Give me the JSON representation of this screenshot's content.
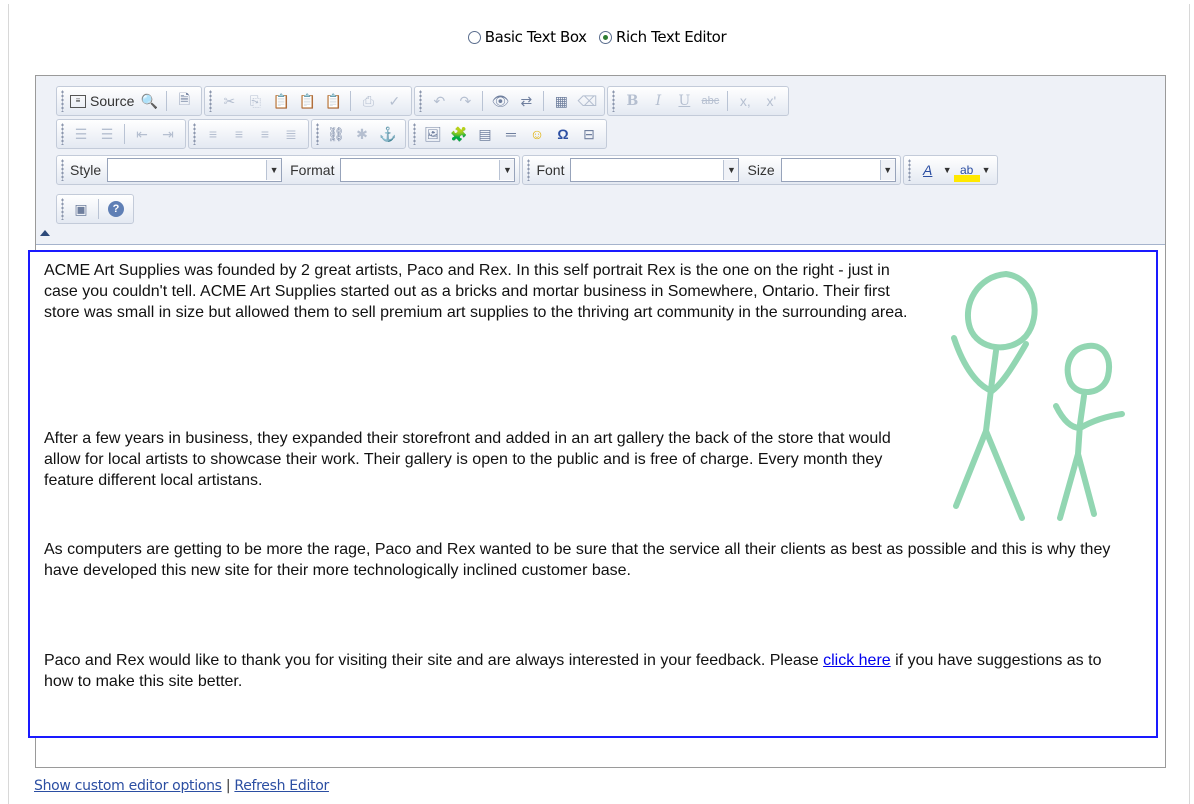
{
  "mode_selector": {
    "basic_label": "Basic Text Box",
    "rich_label": "Rich Text Editor",
    "selected": "Rich Text Editor"
  },
  "toolbar": {
    "source_label": "Source",
    "style_label": "Style",
    "style_value": "",
    "format_label": "Format",
    "format_value": "",
    "font_label": "Font",
    "font_value": "",
    "size_label": "Size",
    "size_value": "",
    "bold_glyph": "B",
    "italic_glyph": "I",
    "underline_glyph": "U",
    "strike_glyph": "abc",
    "subscript_glyph": "x,",
    "superscript_glyph": "x'",
    "omega_glyph": "Ω",
    "text_color_glyph": "A",
    "bg_color_glyph": "ab"
  },
  "content": {
    "p1": "ACME Art Supplies was founded by 2 great artists, Paco and Rex.  In this self portrait Rex is the one on the right - just in case you couldn't tell.  ACME Art Supplies started out as a bricks and mortar business in Somewhere, Ontario.  Their first store was small in size but allowed them to sell premium art supplies to the thriving art community in the surrounding area.",
    "p2": "After a few years in business, they expanded their storefront and added in an art gallery the back of the store that would allow for local artists to showcase their work.  Their gallery is open to the public and is free of charge.  Every month they feature different local artistans.",
    "p3": "As computers are getting to be more the rage, Paco and Rex wanted to be sure that the service all their clients as best as possible and this is why they have developed this new site for their more technologically inclined customer base.",
    "p4_before": "Paco and Rex would like to thank you for visiting their site and are always interested in your feedback.  Please ",
    "p4_link": "click here",
    "p4_after": " if you have suggestions as to how to make this site better."
  },
  "footer": {
    "custom_options_link": "Show custom editor options",
    "separator": "|",
    "refresh_link": "Refresh Editor"
  },
  "colors": {
    "content_border": "#1a1aff",
    "link": "#0000ee",
    "toolbar_bg": "#eef1f7",
    "drawing": "#7fcfa5"
  }
}
